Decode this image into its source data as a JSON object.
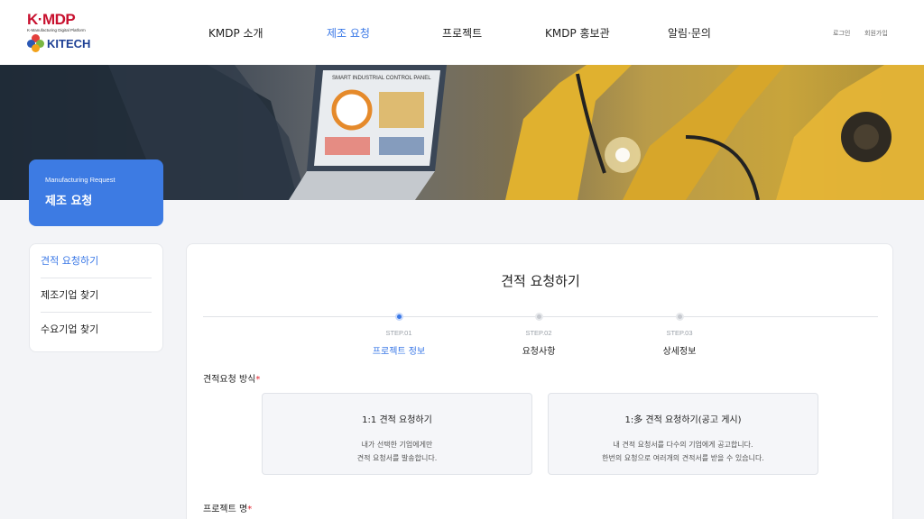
{
  "brand": {
    "logo_main": "K·MDP",
    "logo_sub": "K-Manufacturing Digital Platform",
    "logo_partner": "KITECH"
  },
  "nav": {
    "items": [
      {
        "label": "KMDP 소개"
      },
      {
        "label": "제조 요청"
      },
      {
        "label": "프로젝트"
      },
      {
        "label": "KMDP 홍보관"
      },
      {
        "label": "알림·문의"
      }
    ],
    "active_index": 1,
    "login": "로그인",
    "signup": "회원가입"
  },
  "hero": {
    "badge_en": "Manufacturing Request",
    "badge_ko": "제조 요청",
    "laptop_screen_text": "SMART INDUSTRIAL CONTROL PANEL"
  },
  "sidebar": {
    "items": [
      {
        "label": "견적 요청하기"
      },
      {
        "label": "제조기업 찾기"
      },
      {
        "label": "수요기업 찾기"
      }
    ],
    "active_index": 0
  },
  "main": {
    "title": "견적 요청하기",
    "steps": [
      {
        "no": "STEP.01",
        "name": "프로젝트 정보"
      },
      {
        "no": "STEP.02",
        "name": "요청사항"
      },
      {
        "no": "STEP.03",
        "name": "상세정보"
      }
    ],
    "active_step": 0,
    "method_label": "견적요청 방식",
    "required_mark": "*",
    "options": [
      {
        "title": "1:1 견적 요청하기",
        "desc1": "내가 선택한 기업에게만",
        "desc2": "견적 요청서를 발송합니다."
      },
      {
        "title": "1:多 견적 요청하기(공고 게시)",
        "desc1": "내 견적 요청서를 다수의 기업에게 공고합니다.",
        "desc2": "한번의 요청으로 여러개의 견적서를 받을 수 있습니다."
      }
    ],
    "project_name_label": "프로젝트 명"
  },
  "colors": {
    "accent": "#3a78e7",
    "required": "#e3232e",
    "brand_red": "#c8102e",
    "brand_blue": "#1d3f94"
  }
}
